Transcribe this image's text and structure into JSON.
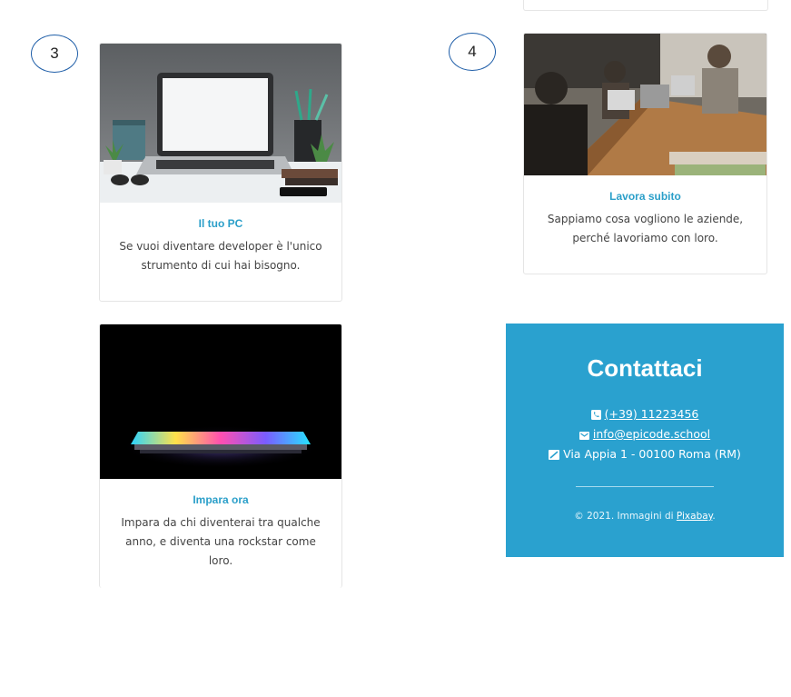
{
  "steps": {
    "three": "3",
    "four": "4"
  },
  "cards": {
    "pc": {
      "title": "Il tuo PC",
      "text_line1": "Se vuoi diventare developer è l'unico",
      "text_line2": "strumento di cui hai bisogno."
    },
    "work": {
      "title": "Lavora subito",
      "text_line1": "Sappiamo cosa vogliono le aziende,",
      "text_line2": "perché lavoriamo con loro."
    },
    "learn": {
      "title": "Impara ora",
      "text_line1": "Impara da chi diventerai tra qualche",
      "text_line2": "anno, e diventa una rockstar come loro."
    }
  },
  "contact": {
    "title": "Contattaci",
    "phone": "(+39) 11223456",
    "email": "info@epicode.school",
    "address": "Via Appia 1 - 00100 Roma (RM)",
    "copyright_prefix": "© 2021. Immagini di ",
    "copyright_link": "Pixabay",
    "copyright_suffix": "."
  },
  "colors": {
    "accent": "#2b9fc9",
    "contact_bg": "#2aa1cf",
    "badge_border": "#1f5ea8"
  },
  "icons": {
    "phone": "phone-icon",
    "email": "envelope-icon",
    "address": "map-icon"
  }
}
